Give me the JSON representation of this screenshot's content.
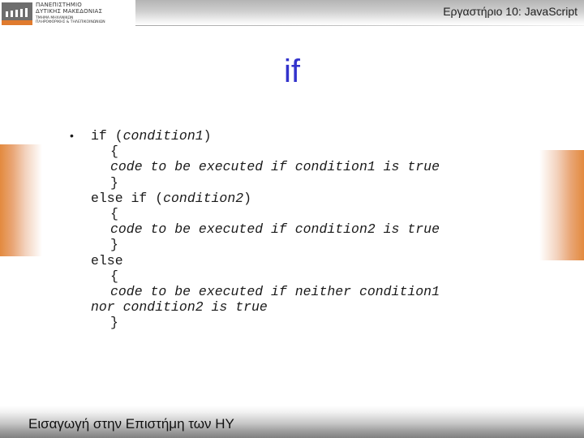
{
  "header": {
    "logo": {
      "line1": "ΠΑΝΕΠΙΣΤΗΜΙΟ",
      "line2": "ΔΥΤΙΚΗΣ ΜΑΚΕΔΟΝΙΑΣ",
      "line3": "ΤΜΗΜΑ ΜΗΧΑΝΙΚΩΝ",
      "line4": "ΠΛΗΡΟΦΟΡΙΚΗΣ & ΤΗΛΕΠΙΚΟΙΝΩΝΙΩΝ"
    },
    "title": "Εργαστήριο 10: JavaScript"
  },
  "slide": {
    "title": "if",
    "bullet_symbol": "•",
    "code": {
      "l1_kw": "if (",
      "l1_it": "condition1",
      "l1_end": ")",
      "l2": "{",
      "l3": "code to be executed if condition1 is true",
      "l4": "}",
      "l5_kw": "else if (",
      "l5_it": "condition2",
      "l5_end": ")",
      "l6": "{",
      "l7": "code to be executed if condition2 is true",
      "l8": "}",
      "l9": "else",
      "l10": "{",
      "l11": "code to be executed if neither condition1",
      "l12": "nor condition2 is true",
      "l13": "}"
    }
  },
  "footer": {
    "text": "Εισαγωγή στην Επιστήμη των HY"
  },
  "colors": {
    "title": "#3333cc",
    "accent_orange": "#e38a3e"
  }
}
